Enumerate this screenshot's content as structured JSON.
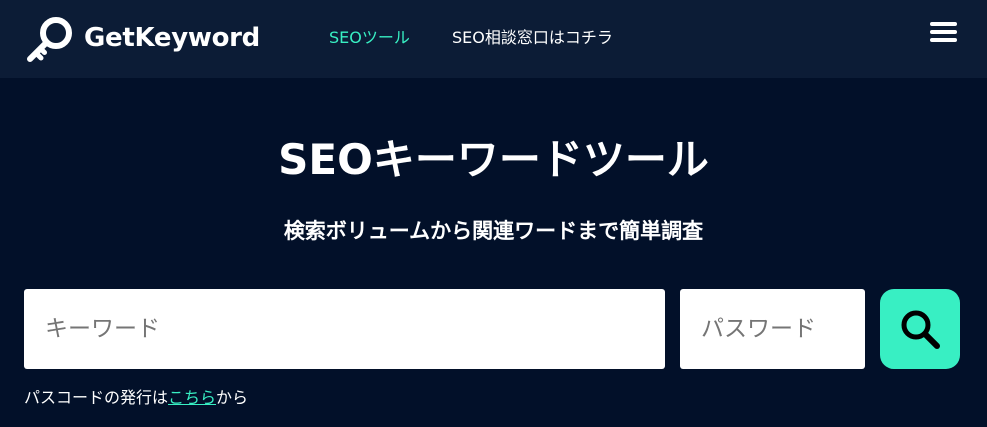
{
  "header": {
    "logo_icon": "magnifier-key-icon",
    "logo_text": "GetKeyword",
    "nav": [
      {
        "label": "SEOツール",
        "color": "#38efc3"
      },
      {
        "label": "SEO相談窓口はコチラ"
      }
    ],
    "menu_icon": "hamburger-menu-icon"
  },
  "hero": {
    "title": "SEOキーワードツール",
    "subtitle": "検索ボリュームから関連ワードまで簡単調査"
  },
  "search": {
    "keyword_placeholder": "キーワード",
    "keyword_value": "",
    "password_placeholder": "パスワード",
    "password_value": "",
    "button_icon": "search-icon",
    "button_color": "#38efc3"
  },
  "passcode": {
    "before": "パスコードの発行は",
    "link": "こちら",
    "after": "から"
  },
  "colors": {
    "background": "#021029",
    "header": "#0c1c36",
    "accent": "#38efc3"
  }
}
